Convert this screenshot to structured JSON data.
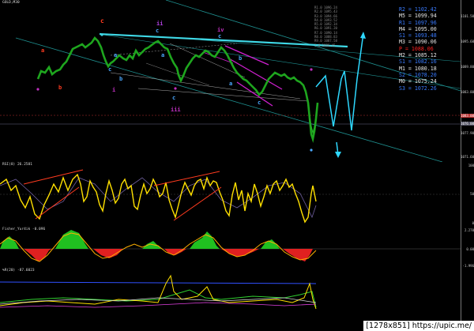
{
  "main": {
    "symbol_label": "GOLD,M30",
    "price_ticks": [
      "1101.50",
      "1095.60",
      "1089.80",
      "1083.80",
      "1077.90",
      "1071.60"
    ],
    "current_price": "1083.00",
    "price_low_tag": "1076.00",
    "colors": {
      "up": "#1e9e1e",
      "down": "#1e9e1e",
      "fan": "#4fd6e0",
      "trend": "#00e5ff",
      "pink": "#d020d0",
      "cyan_proj": "#2ed8ff"
    },
    "level_labels": [
      "R1.0 1096.24",
      "R2.0 1095.43",
      "R3.0 1094.66",
      "R4.0 1093.52",
      "R5.0 1092.34",
      "R6.0 1091.20",
      "R7.0 1090.14",
      "R8.0 1088.83",
      "R9.0 1087.58",
      "1.0 1086.45"
    ]
  },
  "waves": [
    {
      "id": "c-red-top",
      "text": "c",
      "color": "#ff3b1f"
    },
    {
      "id": "a-red",
      "text": "a",
      "color": "#ff3b1f"
    },
    {
      "id": "b-red",
      "text": "b",
      "color": "#ff3b1f"
    },
    {
      "id": "ii",
      "text": "ii",
      "color": "#b040e0"
    },
    {
      "id": "c-blue-1",
      "text": "c",
      "color": "#4aa8ff"
    },
    {
      "id": "a-blue-1",
      "text": "a",
      "color": "#4aa8ff"
    },
    {
      "id": "c-blue-2",
      "text": "c",
      "color": "#4aa8ff"
    },
    {
      "id": "b-blue-1",
      "text": "b",
      "color": "#4aa8ff"
    },
    {
      "id": "i",
      "text": "i",
      "color": "#c030c0"
    },
    {
      "id": "a-blue-2",
      "text": "a",
      "color": "#4aa8ff"
    },
    {
      "id": "c-blue-3",
      "text": "c",
      "color": "#4aa8ff"
    },
    {
      "id": "iii",
      "text": "iii",
      "color": "#c030c0"
    },
    {
      "id": "iv",
      "text": "iv",
      "color": "#c030c0"
    },
    {
      "id": "c-blue-4",
      "text": "c",
      "color": "#4aa8ff"
    },
    {
      "id": "b-blue-2",
      "text": "b",
      "color": "#4aa8ff"
    },
    {
      "id": "a-blue-3",
      "text": "a",
      "color": "#4aa8ff"
    },
    {
      "id": "c-blue-5",
      "text": "c",
      "color": "#4aa8ff"
    }
  ],
  "pivots": [
    {
      "label": "R2",
      "value": "1102.42",
      "color": "#3a7bff"
    },
    {
      "label": "M5",
      "value": "1099.94",
      "color": "#e6e6e6"
    },
    {
      "label": "R1",
      "value": "1097.96",
      "color": "#3a7bff"
    },
    {
      "label": "M4",
      "value": "1095.00",
      "color": "#e6e6e6"
    },
    {
      "label": "S1",
      "value": "1093.48",
      "color": "#3a7bff"
    },
    {
      "label": "M3",
      "value": "1090.06",
      "color": "#e6e6e6"
    },
    {
      "label": "P",
      "value": "1088.06",
      "color": "#ff2020"
    },
    {
      "label": "M2",
      "value": "1085.12",
      "color": "#e6e6e6"
    },
    {
      "label": "S1",
      "value": "1082.16",
      "color": "#3a7bff"
    },
    {
      "label": "M1",
      "value": "1080.18",
      "color": "#e6e6e6"
    },
    {
      "label": "S2",
      "value": "1078.20",
      "color": "#3a7bff"
    },
    {
      "label": "M0",
      "value": "1075.24",
      "color": "#e6e6e6"
    },
    {
      "label": "S3",
      "value": "1072.26",
      "color": "#3a7bff"
    }
  ],
  "rsi": {
    "label": "RSI(8) 26.2581",
    "ticks": [
      "100",
      "50",
      "0"
    ]
  },
  "fisher": {
    "label": "Fisher_Yur4ik -0.096",
    "ticks": [
      "2.270",
      "0.00",
      "-1.996"
    ]
  },
  "wpr": {
    "label": "%R(20) -87.6023",
    "ticks": [
      "-",
      "-"
    ]
  },
  "watermark": "[1278x851] https://upic.me/"
}
